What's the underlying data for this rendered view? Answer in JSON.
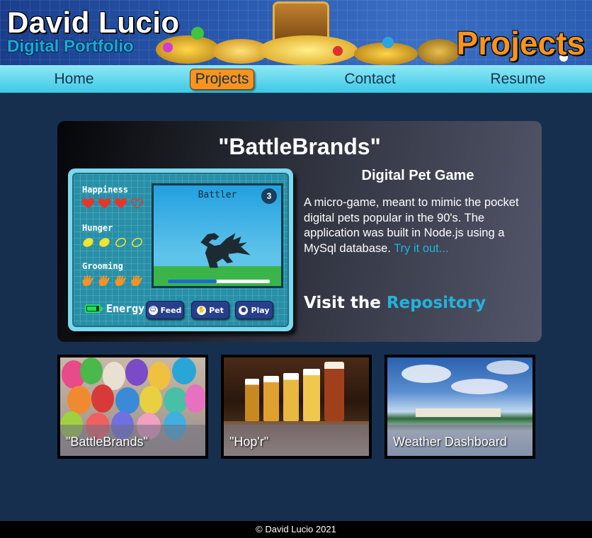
{
  "header": {
    "title": "David Lucio",
    "subtitle": "Digital Portfolio",
    "page_heading": "Projects"
  },
  "nav": {
    "items": [
      {
        "label": "Home",
        "active": false
      },
      {
        "label": "Projects",
        "active": true
      },
      {
        "label": "Contact",
        "active": false
      },
      {
        "label": "Resume",
        "active": false
      }
    ]
  },
  "feature": {
    "title": "\"BattleBrands\"",
    "subtitle": "Digital Pet Game",
    "description": "A micro-game, meant to mimic the pocket digital pets popular in the 90's. The application was built in Node.js using a MySql database.",
    "try_link": "Try it out...",
    "visit_prefix": "Visit the",
    "repo_link": "Repository",
    "game": {
      "stats": [
        {
          "label": "Happiness",
          "icon": "heart-icon",
          "filled": 3,
          "total": 4,
          "color": "#e8352a"
        },
        {
          "label": "Hunger",
          "icon": "lemon-icon",
          "filled": 2,
          "total": 4,
          "color": "#f2e52b"
        },
        {
          "label": "Grooming",
          "icon": "hand-icon",
          "filled": 4,
          "total": 4,
          "color": "#f7931e"
        }
      ],
      "pet_name": "Battler",
      "level": "3",
      "progress": 0.48,
      "energy_label": "Energy",
      "energy_level": 0.7,
      "buttons": [
        {
          "label": "Feed",
          "icon": "smiley-icon"
        },
        {
          "label": "Pet",
          "icon": "hand-icon"
        },
        {
          "label": "Play",
          "icon": "ball-icon"
        }
      ]
    }
  },
  "projects": [
    {
      "caption": "\"BattleBrands\""
    },
    {
      "caption": "\"Hop'r\""
    },
    {
      "caption": "Weather Dashboard"
    }
  ],
  "footer": {
    "text": "© David Lucio 2021"
  },
  "colors": {
    "accent": "#f7931e",
    "link": "#22b3dd",
    "background": "#172f4f"
  }
}
